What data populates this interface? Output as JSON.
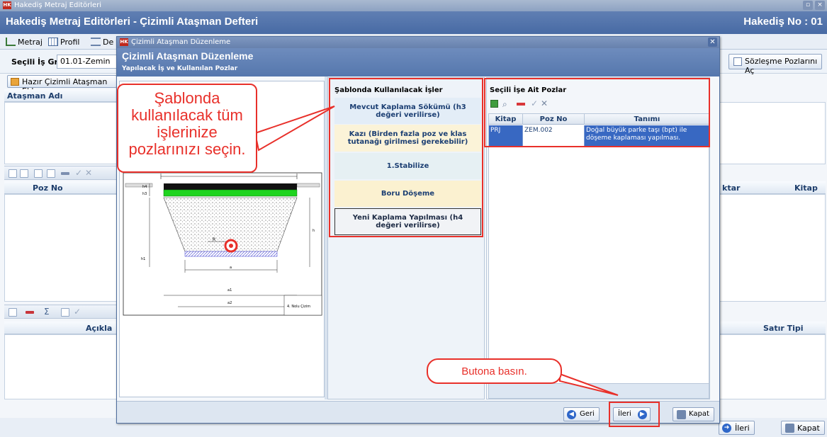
{
  "app": {
    "titlebar_text": "Hakediş Metraj Editörleri",
    "logo_text": "HK",
    "header_title": "Hakediş Metraj Editörleri - Çizimli Ataşman Defteri",
    "header_no": "Hakediş No : 01",
    "tabs": [
      "Metraj",
      "Profil",
      "De"
    ],
    "group_label": "Seçili İş Grubu",
    "group_value": "01.01-Zemin",
    "sozlesme_button": "Sözleşme Pozlarını Aç",
    "add_button": "Hazır Çizimli Ataşman Ekle",
    "atasman_header": "Ataşman Adı",
    "poz_no_header": "Poz No",
    "miktar_header": "ktar",
    "kitap_header": "Kitap",
    "aciklama_header": "Açıkla",
    "satir_tipi_header": "Satır Tipi",
    "ileri_button": "İleri",
    "kapat_button": "Kapat"
  },
  "modal": {
    "window_title": "Çizimli Ataşman Düzenleme",
    "heading": "Çizimli Ataşman Düzenleme",
    "subheading": "Yapılacak İş ve Kullanılan Pozlar",
    "works_title": "Şablonda Kullanılacak İşler",
    "works": [
      "Mevcut Kaplama Sökümü (h3 değeri verilirse)",
      "Kazı (Birden fazla poz ve klas tutanağı girilmesi gerekebilir)",
      "1.Stabilize",
      "Boru Döşeme",
      "Yeni Kaplama Yapılması (h4 değeri verilirse)"
    ],
    "pozlar_title": "Seçili İşe Ait Pozlar",
    "columns": [
      "Kitap",
      "Poz No",
      "Tanımı"
    ],
    "rows": [
      {
        "kitap": "PRJ",
        "poz_no": "ZEM.002",
        "tanimi": "Doğal büyük parke taşı (bpt) ile döşeme kaplaması yapılması."
      }
    ],
    "geri_button": "Geri",
    "ileri_button": "İleri",
    "kapat_button": "Kapat"
  },
  "drawing": {
    "labels": [
      "h4",
      "h3",
      "R",
      "h1",
      "h",
      "a",
      "a1",
      "a2"
    ],
    "note": "4. Nolu Çizim"
  },
  "callouts": {
    "instruction": "Şablonda kullanılacak tüm işlerinize pozlarınızı seçin.",
    "instruction_lines": [
      "Şablonda",
      "kullanılacak tüm",
      "işlerinize",
      "pozlarınızı seçin."
    ],
    "press_button": "Butona basın."
  },
  "colors": {
    "header_blue": "#4f72ab",
    "selected_row": "#3868c2",
    "callout_red": "#e8302a",
    "work_selected_bg": "#fbf3d8"
  }
}
